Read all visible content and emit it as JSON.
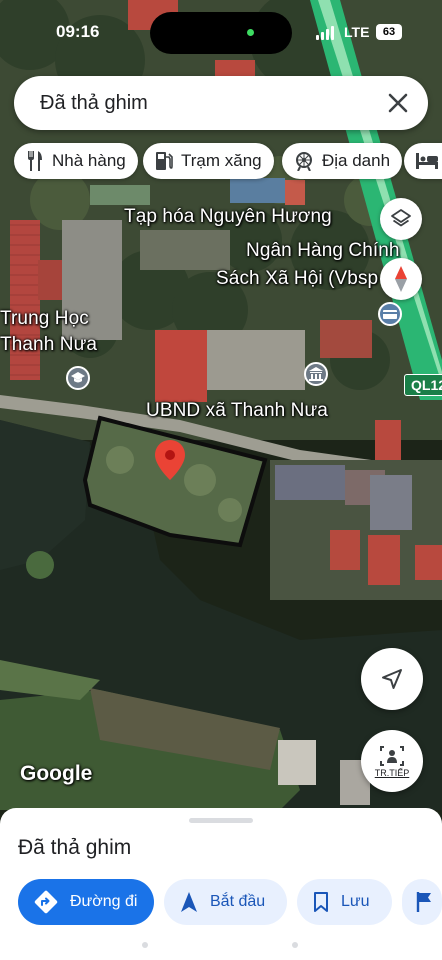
{
  "status_bar": {
    "time": "09:16",
    "network": "LTE",
    "battery": "63"
  },
  "search": {
    "value": "Đã thả ghim"
  },
  "chips": [
    {
      "label": "Nhà hàng",
      "icon": "restaurant-icon"
    },
    {
      "label": "Trạm xăng",
      "icon": "gas-station-icon"
    },
    {
      "label": "Địa danh",
      "icon": "landmark-icon"
    },
    {
      "label": "",
      "icon": "hotel-icon"
    }
  ],
  "map": {
    "labels": {
      "shop": "Tạp hóa Nguyên Hương",
      "bank_line1": "Ngân Hàng Chính",
      "bank_line2": "Sách Xã Hội (Vbsp",
      "school_line1": "Trung Học",
      "school_line2": "Thanh Nưa",
      "office": "UBND xã Thanh Nưa"
    },
    "road_shield": "QL12",
    "attribution": "Google",
    "street_view_label": "TR.TIẾP"
  },
  "sheet": {
    "title": "Đã thả ghim",
    "actions": {
      "directions": "Đường đi",
      "start": "Bắt đầu",
      "save": "Lưu"
    }
  },
  "colors": {
    "accent": "#1a73e8",
    "pin": "#ea4335",
    "road_green": "#2bb673"
  }
}
